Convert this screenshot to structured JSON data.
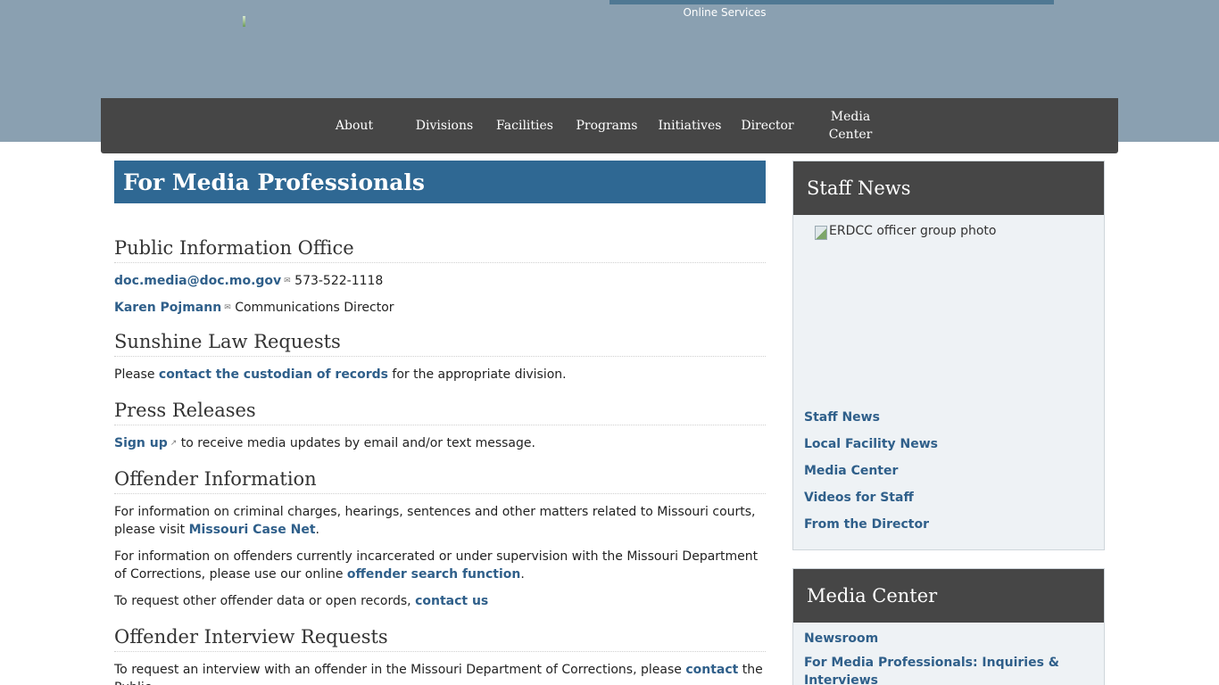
{
  "header": {
    "online_services": "Online Services"
  },
  "nav": {
    "about": "About",
    "divisions": "Divisions",
    "facilities": "Facilities",
    "programs": "Programs",
    "initiatives": "Initiatives",
    "director": "Director",
    "media_line1": "Media",
    "media_line2": "Center"
  },
  "main": {
    "title": "For Media Professionals",
    "pio": {
      "heading": "Public Information Office",
      "email": "doc.media@doc.mo.gov",
      "phone": "573-522-1118",
      "contact_name": "Karen Pojmann",
      "contact_role": "Communications Director"
    },
    "sunshine": {
      "heading": "Sunshine Law Requests",
      "pre": "Please ",
      "link": "contact the custodian of records",
      "post": " for the appropriate division."
    },
    "press": {
      "heading": "Press Releases",
      "link": "Sign up",
      "post": "to receive media updates by email and/or text message."
    },
    "offender_info": {
      "heading": "Offender Information",
      "p1_text": "For information on criminal charges, hearings, sentences and other matters related to Missouri courts, please visit ",
      "p1_link": "Missouri Case Net",
      "p1_end": ".",
      "p2_text": "For information on offenders currently incarcerated or under supervision with the Missouri Department of Corrections, please use our online ",
      "p2_link": "offender search function",
      "p2_end": ".",
      "p3_text": "To request other offender data or open records, ",
      "p3_link": "contact us"
    },
    "interview": {
      "heading": "Offender Interview Requests",
      "text": "To request an interview with an offender in the Missouri Department of Corrections, please ",
      "link": "contact",
      "post": " the Public"
    }
  },
  "sidebar": {
    "staff_news": {
      "title": "Staff News",
      "image_alt": "ERDCC officer group photo",
      "links": [
        "Staff News",
        "Local Facility News",
        "Media Center",
        "Videos for Staff",
        "From the Director"
      ]
    },
    "media_center": {
      "title": "Media Center",
      "links": [
        "Newsroom",
        "For Media Professionals: Inquiries & Interviews"
      ]
    }
  }
}
